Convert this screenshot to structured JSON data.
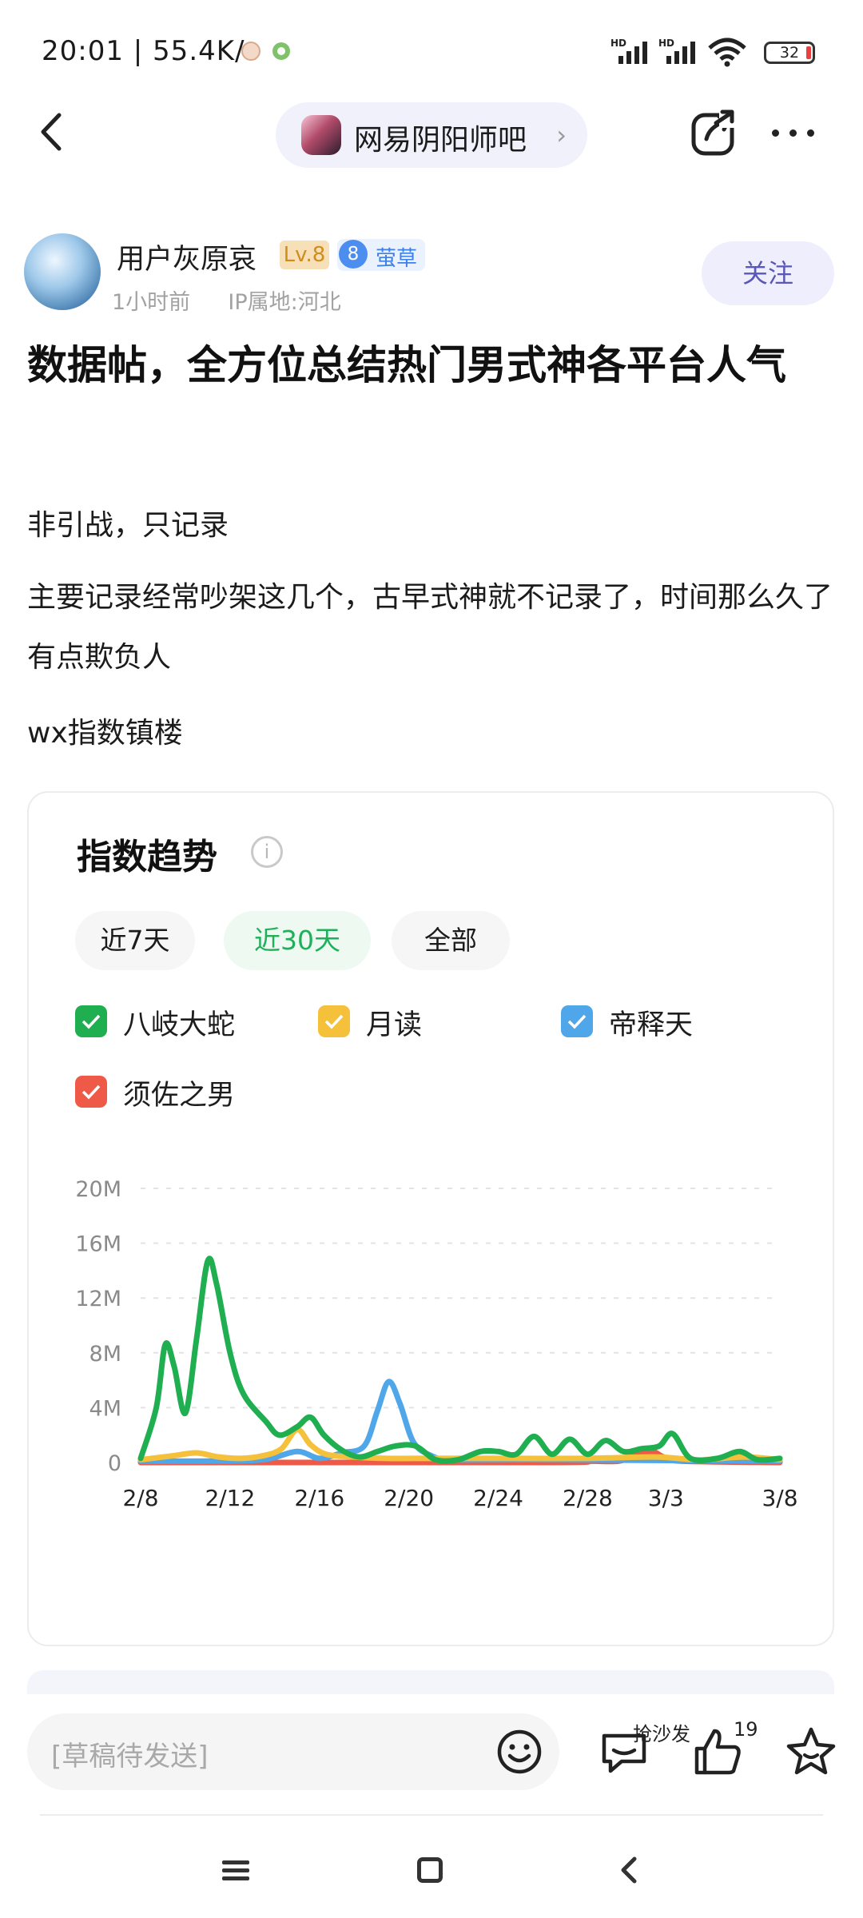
{
  "status_bar": {
    "time_speed": "20:01 | 55.4K/s",
    "battery": "32",
    "hd1": "HD",
    "hd2": "HD"
  },
  "nav": {
    "back_icon": "chevron-left-icon",
    "forum_name": "网易阴阳师吧",
    "share_icon": "share-icon",
    "more_icon": "more-icon"
  },
  "author": {
    "name": "用户灰原哀",
    "level": "Lv.8",
    "rank_num": "8",
    "rank_label": "萤草",
    "time": "1小时前",
    "ip": "IP属地:河北",
    "follow_label": "关注"
  },
  "post": {
    "title": "数据帖，全方位总结热门男式神各平台人气",
    "paragraphs": [
      "非引战，只记录",
      "主要记录经常吵架这几个，古早式神就不记录了，时间那么久了有点欺负人",
      "wx指数镇楼"
    ]
  },
  "card": {
    "title": "指数趋势",
    "info_icon": "i",
    "tabs": [
      {
        "label": "近7天",
        "active": false
      },
      {
        "label": "近30天",
        "active": true
      },
      {
        "label": "全部",
        "active": false
      }
    ]
  },
  "chart_data": {
    "type": "line",
    "title": "",
    "xlabel": "",
    "ylabel": "",
    "ylim": [
      0,
      20
    ],
    "y_unit": "M",
    "y_ticks": [
      "0",
      "4M",
      "8M",
      "12M",
      "16M",
      "20M"
    ],
    "x_ticks": [
      "2/8",
      "2/12",
      "2/16",
      "2/20",
      "2/24",
      "2/28",
      "3/3",
      "3/8"
    ],
    "grid": true,
    "legend_position": "top",
    "series": [
      {
        "name": "八岐大蛇",
        "color": "#1fae50",
        "points": [
          [
            0,
            0.3
          ],
          [
            0.7,
            4
          ],
          [
            1.1,
            8.6
          ],
          [
            1.5,
            7
          ],
          [
            2,
            3.6
          ],
          [
            2.5,
            9
          ],
          [
            3,
            14.7
          ],
          [
            3.4,
            13
          ],
          [
            4,
            8
          ],
          [
            4.6,
            5
          ],
          [
            5.6,
            3
          ],
          [
            6.2,
            2
          ],
          [
            7,
            2.6
          ],
          [
            7.6,
            3.3
          ],
          [
            8.2,
            2
          ],
          [
            9,
            0.9
          ],
          [
            9.8,
            0.4
          ],
          [
            10.6,
            0.8
          ],
          [
            11.4,
            1.2
          ],
          [
            12.3,
            1.2
          ],
          [
            13.2,
            0.2
          ],
          [
            14.2,
            0.2
          ],
          [
            15.2,
            0.8
          ],
          [
            16,
            0.8
          ],
          [
            16.8,
            0.6
          ],
          [
            17.6,
            1.9
          ],
          [
            18.4,
            0.6
          ],
          [
            19.2,
            1.7
          ],
          [
            20,
            0.6
          ],
          [
            20.8,
            1.6
          ],
          [
            21.6,
            0.8
          ],
          [
            22.4,
            1
          ],
          [
            23.2,
            1.2
          ],
          [
            23.8,
            2.1
          ],
          [
            24.6,
            0.3
          ],
          [
            25.8,
            0.3
          ],
          [
            26.8,
            0.8
          ],
          [
            27.6,
            0.2
          ],
          [
            28.6,
            0.3
          ]
        ]
      },
      {
        "name": "月读",
        "color": "#f5c03a",
        "points": [
          [
            0,
            0.2
          ],
          [
            1.5,
            0.5
          ],
          [
            2.5,
            0.7
          ],
          [
            3.5,
            0.4
          ],
          [
            4.5,
            0.3
          ],
          [
            5.5,
            0.5
          ],
          [
            6.3,
            1
          ],
          [
            7,
            2.4
          ],
          [
            7.6,
            1.3
          ],
          [
            8.3,
            0.6
          ],
          [
            9.5,
            0.4
          ],
          [
            11,
            0.3
          ],
          [
            13,
            0.3
          ],
          [
            16,
            0.3
          ],
          [
            20,
            0.3
          ],
          [
            23,
            0.4
          ],
          [
            25,
            0.2
          ],
          [
            27,
            0.4
          ],
          [
            28.6,
            0.2
          ]
        ]
      },
      {
        "name": "帝释天",
        "color": "#4fa6e8",
        "points": [
          [
            0,
            0.1
          ],
          [
            3,
            0.1
          ],
          [
            5.5,
            0.2
          ],
          [
            7,
            0.8
          ],
          [
            8,
            0.3
          ],
          [
            9,
            0.7
          ],
          [
            10,
            1.2
          ],
          [
            10.6,
            3.8
          ],
          [
            11.1,
            5.9
          ],
          [
            11.6,
            4.3
          ],
          [
            12.2,
            1.5
          ],
          [
            13,
            0.5
          ],
          [
            14,
            0.2
          ],
          [
            18,
            0.2
          ],
          [
            28.6,
            0.1
          ]
        ]
      },
      {
        "name": "须佐之男",
        "color": "#ef5a48",
        "points": [
          [
            0,
            0
          ],
          [
            18,
            0
          ],
          [
            20,
            0.1
          ],
          [
            21.4,
            0.1
          ],
          [
            22.2,
            0.6
          ],
          [
            22.9,
            0.8
          ],
          [
            23.4,
            0.4
          ],
          [
            24.2,
            0.1
          ],
          [
            28.6,
            0
          ]
        ]
      }
    ]
  },
  "bottom_bar": {
    "comment_placeholder": "[草稿待发送]",
    "emoji_icon": "emoji-icon",
    "sofa_label": "抢沙发",
    "like_count": "19",
    "star_icon": "star-icon"
  },
  "system_nav": {
    "menu_icon": "menu-icon",
    "home_icon": "home-icon",
    "back_icon": "back-icon"
  }
}
